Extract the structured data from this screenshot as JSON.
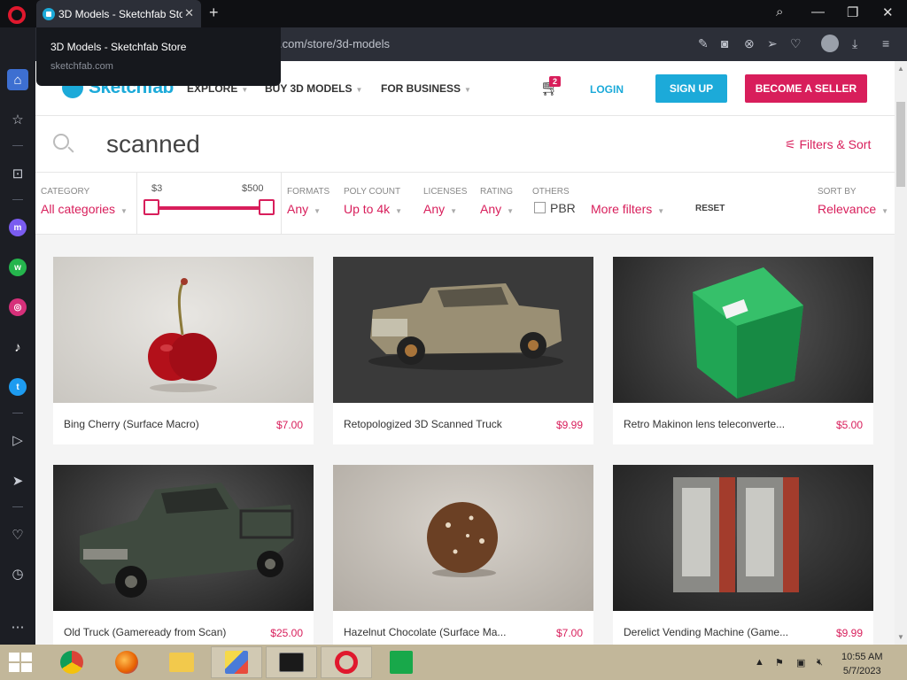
{
  "browser": {
    "tab_title": "3D Models - Sketchfab Store",
    "tab_close": "✕",
    "new_tab": "+",
    "url_visible": ".com/store/3d-models",
    "tooltip": {
      "title": "3D Models - Sketchfab Store",
      "url": "sketchfab.com"
    },
    "window_controls": {
      "search": "⌕",
      "minimize": "—",
      "restore": "❐",
      "close": "✕"
    }
  },
  "sidebar": {
    "items": [
      "home-icon",
      "star-icon",
      "bag-icon",
      "messenger-icon",
      "whatsapp-icon",
      "instagram-icon",
      "tiktok-icon",
      "twitter-icon",
      "player-icon",
      "send-icon",
      "heart-icon",
      "clock-icon",
      "more-icon"
    ]
  },
  "site": {
    "logo": "Sketchfab",
    "nav": {
      "explore": "EXPLORE",
      "buy": "BUY 3D MODELS",
      "business": "FOR BUSINESS"
    },
    "cart_count": "2",
    "login": "LOGIN",
    "signup": "SIGN UP",
    "seller": "BECOME A SELLER"
  },
  "search": {
    "query": "scanned",
    "filters_sort": "Filters & Sort"
  },
  "filters": {
    "category": {
      "label": "CATEGORY",
      "value": "All categories"
    },
    "price": {
      "min": "$3",
      "max": "$500"
    },
    "formats": {
      "label": "FORMATS",
      "value": "Any"
    },
    "poly": {
      "label": "POLY COUNT",
      "value": "Up to 4k"
    },
    "licenses": {
      "label": "LICENSES",
      "value": "Any"
    },
    "rating": {
      "label": "RATING",
      "value": "Any"
    },
    "others": {
      "label": "OTHERS",
      "pbr": "PBR"
    },
    "more": "More filters",
    "reset": "RESET",
    "sort": {
      "label": "SORT BY",
      "value": "Relevance"
    }
  },
  "models": [
    {
      "title": "Bing Cherry (Surface Macro)",
      "price": "$7.00"
    },
    {
      "title": "Retopologized 3D Scanned Truck",
      "price": "$9.99"
    },
    {
      "title": "Retro Makinon lens teleconverte...",
      "price": "$5.00"
    },
    {
      "title": "Old Truck (Gameready from Scan)",
      "price": "$25.00"
    },
    {
      "title": "Hazelnut Chocolate (Surface Ma...",
      "price": "$7.00"
    },
    {
      "title": "Derelict Vending Machine (Game...",
      "price": "$9.99"
    }
  ],
  "taskbar": {
    "apps": [
      "chrome-icon",
      "firefox-icon",
      "file-explorer-icon",
      "paint-icon",
      "terminal-icon",
      "opera-icon",
      "store-icon"
    ],
    "time": "10:55 AM",
    "date": "5/7/2023"
  },
  "colors": {
    "brand_blue": "#1caad9",
    "brand_pink": "#d81e5b",
    "taskbar": "#c2b79a"
  }
}
